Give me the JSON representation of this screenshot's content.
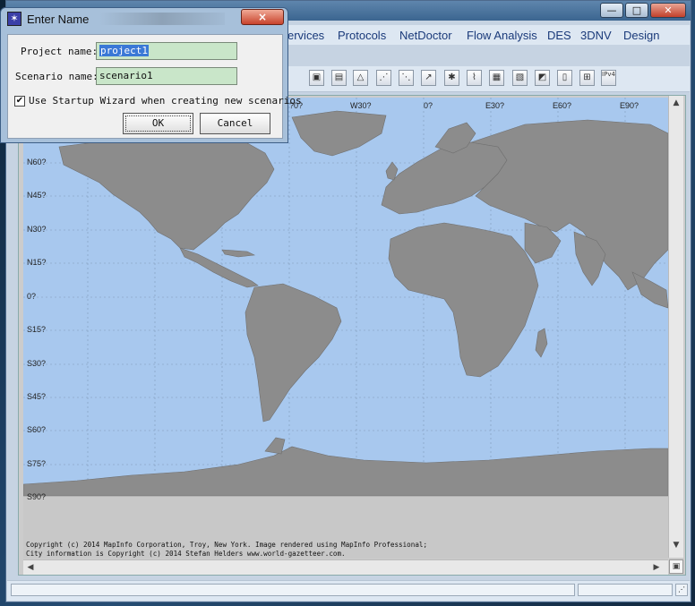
{
  "dialog": {
    "title": "Enter Name",
    "project_label": "Project name:",
    "project_value": "project1",
    "scenario_label": "Scenario name:",
    "scenario_value": "scenario1",
    "wizard_checked": true,
    "wizard_label": "Use Startup Wizard when creating new scenarios",
    "ok_label": "OK",
    "cancel_label": "Cancel",
    "close_icon": "×"
  },
  "menubar": {
    "items": [
      "ervices",
      "Protocols",
      "NetDoctor",
      "Flow Analysis",
      "DES",
      "3DNV",
      "Design"
    ]
  },
  "window_controls": {
    "minimize": "—",
    "maximize": "□",
    "close": "✕"
  },
  "toolbar": {
    "icons": [
      "topology-icon",
      "node-icon",
      "flag-icon",
      "link-icon",
      "config-icon",
      "wireless-icon",
      "antenna-icon",
      "path-icon",
      "grid-icon",
      "chart-icon",
      "report-icon",
      "doc-icon",
      "ipv6-icon",
      "ipv4-icon"
    ],
    "ipv_label": "IPv4"
  },
  "map": {
    "lon_labels": [
      "?0?",
      "W30?",
      "0?",
      "E30?",
      "E60?",
      "E90?"
    ],
    "lat_labels": [
      "N60?",
      "N45?",
      "N30?",
      "N15?",
      "0?",
      "S15?",
      "S30?",
      "S45?",
      "S60?",
      "S75?",
      "S90?"
    ],
    "copyright_line1": "Copyright (c) 2014 MapInfo Corporation, Troy, New York. Image rendered using MapInfo Professional;",
    "copyright_line2": "City information is Copyright (c) 2014 Stefan Helders www.world-gazetteer.com.",
    "ocean_color": "#a8c8ee",
    "land_color": "#8c8c8c"
  }
}
